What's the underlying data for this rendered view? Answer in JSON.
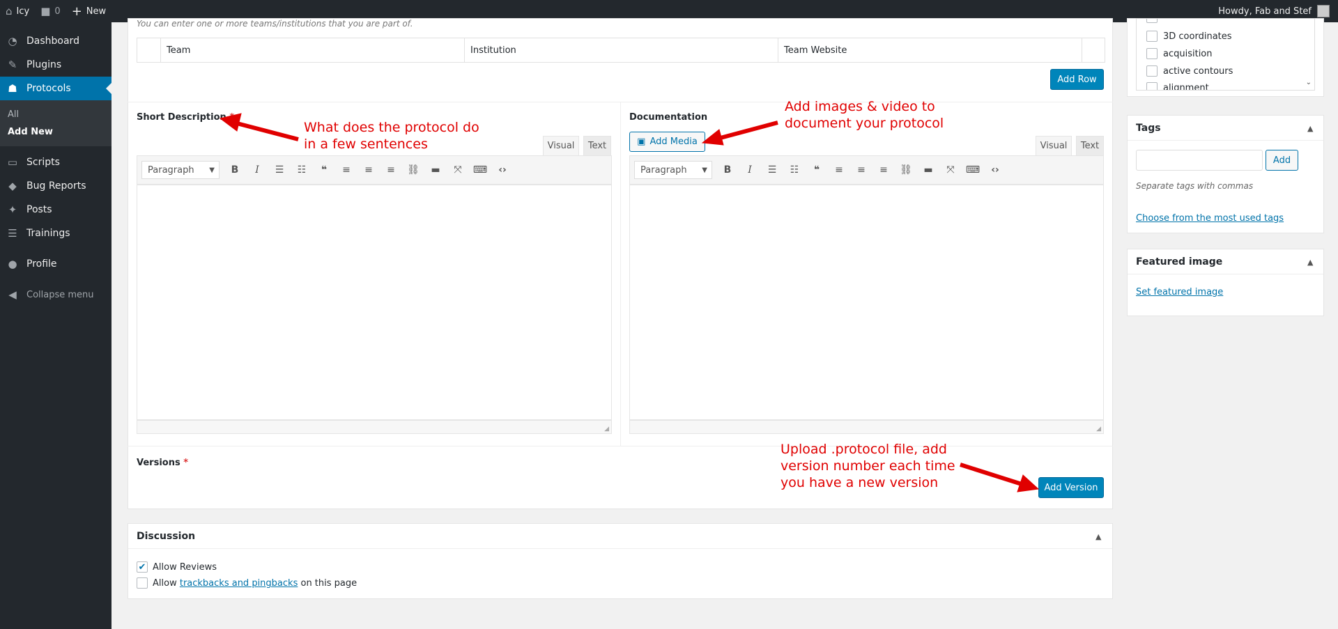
{
  "adminbar": {
    "site": "Icy",
    "comments": "0",
    "new": "New",
    "greeting": "Howdy, Fab and Stef"
  },
  "sidebar": {
    "items": [
      {
        "label": "Dashboard",
        "icon": "dashboard-icon"
      },
      {
        "label": "Plugins",
        "icon": "plugins-icon"
      },
      {
        "label": "Protocols",
        "icon": "protocols-icon"
      },
      {
        "label": "Scripts",
        "icon": "scripts-icon"
      },
      {
        "label": "Bug Reports",
        "icon": "bug-icon"
      },
      {
        "label": "Posts",
        "icon": "pin-icon"
      },
      {
        "label": "Trainings",
        "icon": "trainings-icon"
      },
      {
        "label": "Profile",
        "icon": "profile-icon"
      }
    ],
    "submenu": [
      "All",
      "Add New"
    ],
    "collapse": "Collapse menu"
  },
  "teams": {
    "hint": "You can enter one or more teams/institutions that you are part of.",
    "columns": [
      "Team",
      "Institution",
      "Team Website"
    ],
    "add_row": "Add Row"
  },
  "short_description": {
    "label": "Short Description",
    "required": "*",
    "tab_visual": "Visual",
    "tab_text": "Text",
    "format": "Paragraph"
  },
  "documentation": {
    "label": "Documentation",
    "add_media": "Add Media",
    "tab_visual": "Visual",
    "tab_text": "Text",
    "format": "Paragraph"
  },
  "versions": {
    "label": "Versions",
    "required": "*",
    "add_version": "Add Version"
  },
  "annotations": {
    "short_desc_1": "What does the protocol do",
    "short_desc_2": "in a few sentences",
    "media_1": "Add images & video to",
    "media_2": "document your protocol",
    "version_1": "Upload .protocol file, add",
    "version_2": "version number each time",
    "version_3": "you have a new version",
    "color": "#e00000"
  },
  "discussion": {
    "title": "Discussion",
    "allow_reviews": "Allow Reviews",
    "allow_pre": "Allow",
    "allow_link": "trackbacks and pingbacks",
    "allow_post": "on this page"
  },
  "categories": {
    "items": [
      "3D coordinates",
      "acquisition",
      "active contours",
      "alignment"
    ]
  },
  "tags": {
    "title": "Tags",
    "add": "Add",
    "hint": "Separate tags with commas",
    "most_used": "Choose from the most used tags"
  },
  "featured": {
    "title": "Featured image",
    "set": "Set featured image"
  },
  "colors": {
    "accent": "#0073aa",
    "primary_button": "#0085ba",
    "adminbar": "#23282d"
  }
}
